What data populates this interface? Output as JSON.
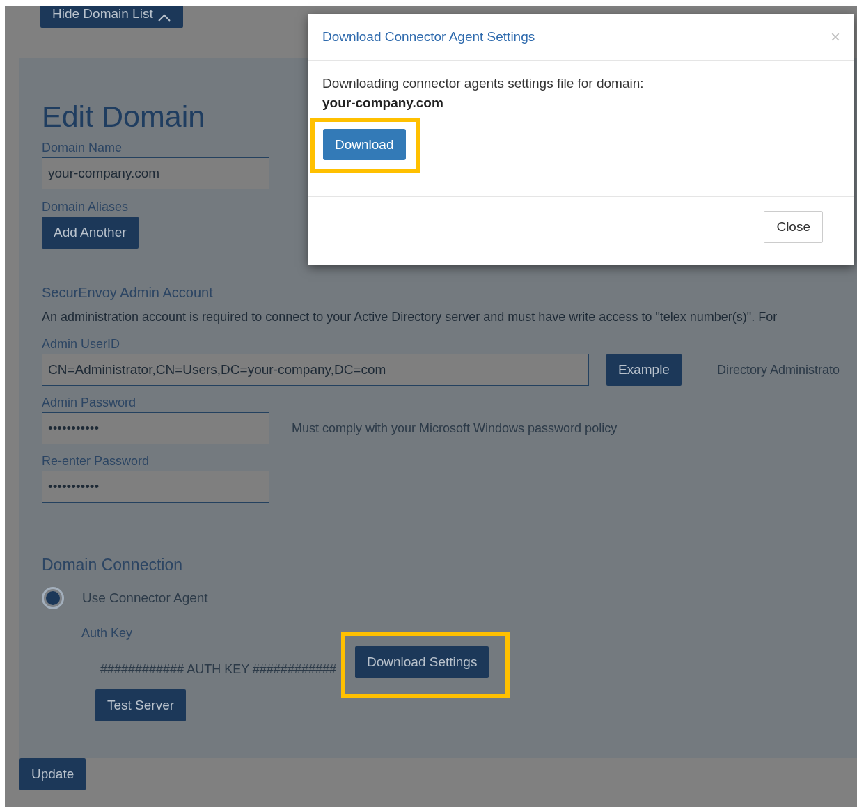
{
  "page": {
    "hide_list_button": "Hide Domain List",
    "title": "Edit Domain",
    "domain_name": {
      "label": "Domain Name",
      "value": "your-company.com"
    },
    "domain_aliases": {
      "label": "Domain Aliases",
      "button": "Add Another"
    },
    "admin_account": {
      "heading": "SecurEnvoy Admin Account",
      "description": "An administration account is required to connect to your Active Directory server and must have write access to \"telex number(s)\". For",
      "user_id": {
        "label": "Admin UserID",
        "value": "CN=Administrator,CN=Users,DC=your-company,DC=com",
        "button": "Example",
        "hint": "Directory Administrato"
      },
      "password": {
        "label": "Admin Password",
        "value": "•••••••••••",
        "hint": "Must comply with your Microsoft Windows password policy"
      },
      "reenter": {
        "label": "Re-enter Password",
        "value": "•••••••••••"
      }
    },
    "connection": {
      "heading": "Domain Connection",
      "option": {
        "label": "Use Connector Agent",
        "selected": true
      },
      "auth_key_label": "Auth Key",
      "auth_key": "############ AUTH KEY ############",
      "download_button": {
        "label": "Download Settings",
        "highlighted": true
      },
      "test_button": "Test Server"
    },
    "update_button": "Update"
  },
  "modal": {
    "title": "Download Connector Agent Settings",
    "close_icon": "×",
    "message": "Downloading connector agents settings file for domain:",
    "domain": "your-company.com",
    "download_button": {
      "label": "Download",
      "highlighted": true
    },
    "close_button": "Close"
  }
}
